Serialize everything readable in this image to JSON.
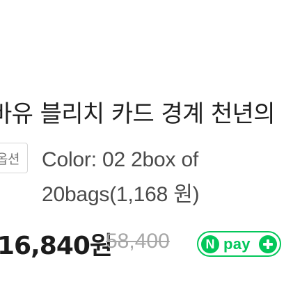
{
  "product": {
    "title": "바유 블리치 카드 경계 천년의",
    "option": {
      "tag_label": "옵션",
      "value": "Color: 02 2box of 20bags(1,168 원)"
    },
    "price": {
      "sale": "16,840원",
      "original": "58,400"
    },
    "payment": {
      "badge_letter": "N",
      "badge_text": "pay",
      "badge_icon": "plus-icon",
      "brand_color": "#03C75A"
    }
  }
}
